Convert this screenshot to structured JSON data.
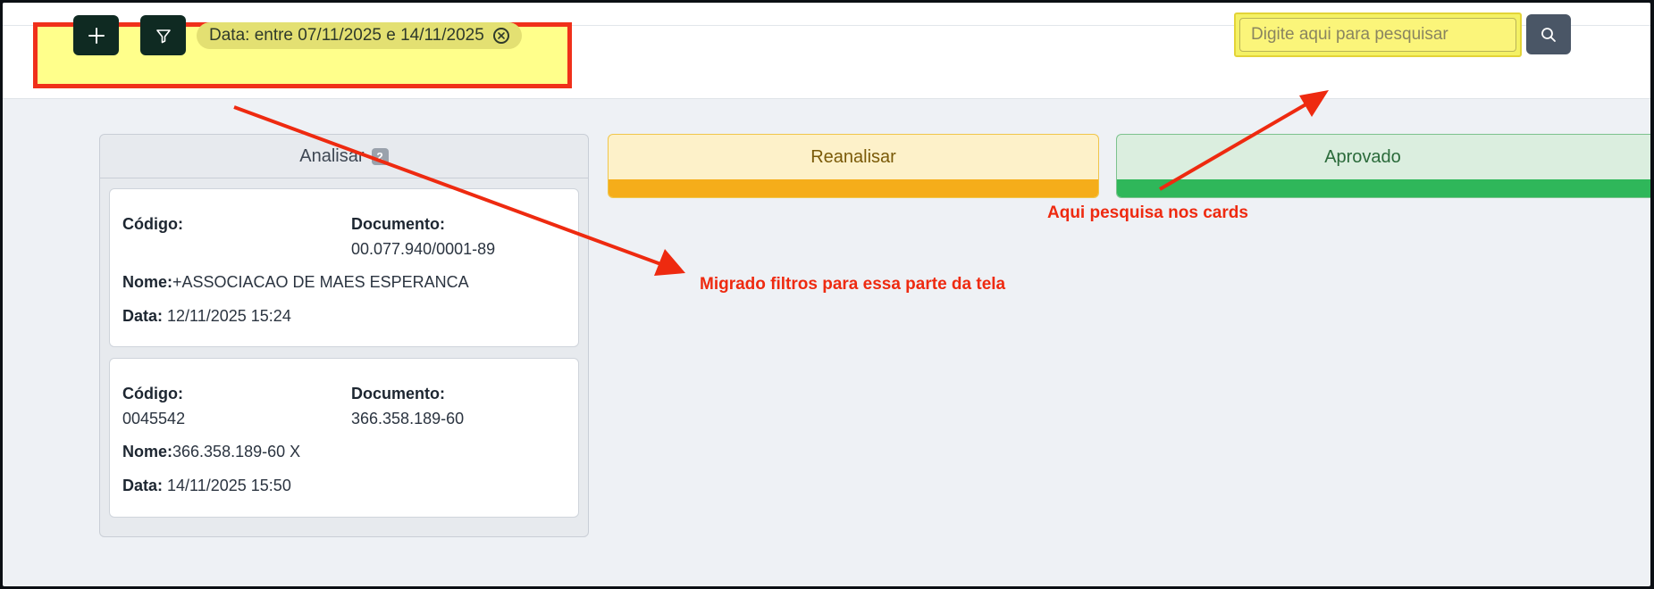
{
  "toolbar": {
    "add_icon": "plus-icon",
    "filter_icon": "filter-icon",
    "filter_chip": {
      "label": "Data: entre 07/11/2025 e 14/11/2025",
      "clear_icon": "close-circle-icon"
    },
    "search": {
      "placeholder": "Digite aqui para pesquisar",
      "button_icon": "search-icon"
    }
  },
  "columns": [
    {
      "title": "Analisar",
      "count": "2",
      "cards": [
        {
          "codigo_label": "Código:",
          "codigo": "",
          "documento_label": "Documento:",
          "documento": "00.077.940/0001-89",
          "nome_label": "Nome:",
          "nome": "+ASSOCIACAO DE MAES ESPERANCA",
          "data_label": "Data:",
          "data": "12/11/2025 15:24"
        },
        {
          "codigo_label": "Código:",
          "codigo": "0045542",
          "documento_label": "Documento:",
          "documento": "366.358.189-60",
          "nome_label": "Nome:",
          "nome": "366.358.189-60 X",
          "data_label": "Data:",
          "data": "14/11/2025 15:50"
        }
      ]
    },
    {
      "title": "Reanalisar"
    },
    {
      "title": "Aprovado"
    }
  ],
  "annotations": {
    "filters_note": "Migrado filtros para essa parte da tela",
    "search_note": "Aqui pesquisa nos cards"
  },
  "colors": {
    "annotation": "#ee2a10",
    "highlight": "#f4f165",
    "dark_button": "#0f2a22",
    "reanalisar_bar": "#f5ad1a",
    "aprovado_bar": "#2fb75a"
  }
}
